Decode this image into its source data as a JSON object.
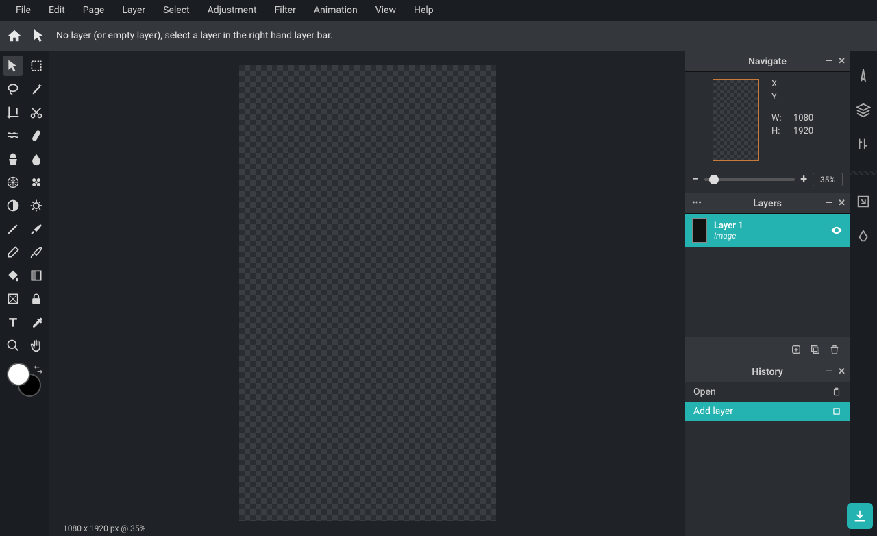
{
  "menubar": [
    "File",
    "Edit",
    "Page",
    "Layer",
    "Select",
    "Adjustment",
    "Filter",
    "Animation",
    "View",
    "Help"
  ],
  "subbar": {
    "message": "No layer (or empty layer), select a layer in the right hand layer bar."
  },
  "navigate": {
    "title": "Navigate",
    "x_label": "X:",
    "x_val": "",
    "y_label": "Y:",
    "y_val": "",
    "w_label": "W:",
    "w_val": "1080",
    "h_label": "H:",
    "h_val": "1920",
    "zoom": "35%"
  },
  "layers": {
    "title": "Layers",
    "items": [
      {
        "name": "Layer 1",
        "type": "Image"
      }
    ]
  },
  "history": {
    "title": "History",
    "items": [
      {
        "label": "Open",
        "selected": false
      },
      {
        "label": "Add layer",
        "selected": true
      }
    ]
  },
  "status": "1080 x 1920 px @ 35%"
}
